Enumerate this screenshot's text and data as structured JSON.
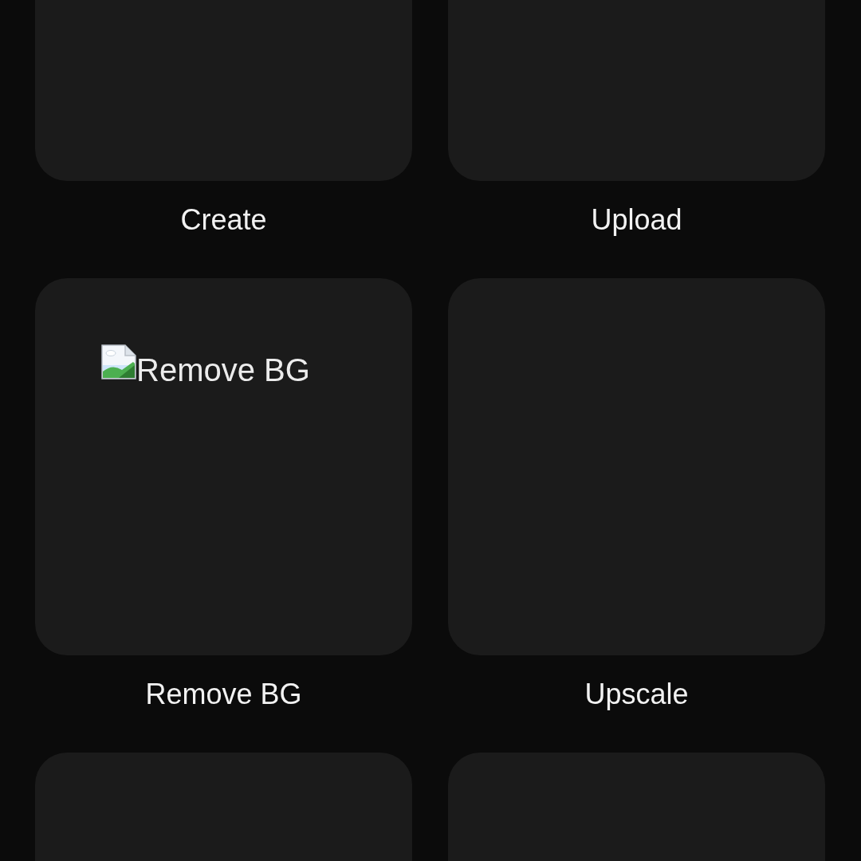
{
  "tiles": [
    {
      "kind": "card",
      "label": "Create"
    },
    {
      "kind": "card",
      "label": "Upload"
    },
    {
      "kind": "card",
      "label": "Remove BG",
      "image": {
        "kind": "broken",
        "alt": "Remove BG"
      }
    },
    {
      "kind": "card",
      "label": "Upscale"
    },
    {
      "kind": "card"
    },
    {
      "kind": "card"
    }
  ]
}
